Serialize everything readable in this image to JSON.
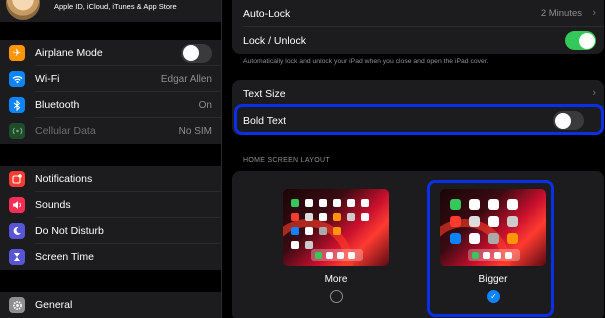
{
  "sidebar": {
    "account_subtitle": "Apple ID, iCloud, iTunes & App Store",
    "group1": [
      {
        "label": "Airplane Mode",
        "icon": "airplane-icon",
        "color": "#ff9500",
        "control": "toggle-off"
      },
      {
        "label": "Wi-Fi",
        "icon": "wifi-icon",
        "color": "#0a84ff",
        "value": "Edgar Allen"
      },
      {
        "label": "Bluetooth",
        "icon": "bluetooth-icon",
        "color": "#0a84ff",
        "value": "On"
      },
      {
        "label": "Cellular Data",
        "icon": "cellular-icon",
        "color": "#34c759",
        "value": "No SIM",
        "dimmed": true
      }
    ],
    "group2": [
      {
        "label": "Notifications",
        "icon": "notifications-icon",
        "color": "#ff3b30"
      },
      {
        "label": "Sounds",
        "icon": "sounds-icon",
        "color": "#ff2d55"
      },
      {
        "label": "Do Not Disturb",
        "icon": "moon-icon",
        "color": "#5856d6"
      },
      {
        "label": "Screen Time",
        "icon": "hourglass-icon",
        "color": "#5856d6"
      }
    ],
    "group3": [
      {
        "label": "General",
        "icon": "gear-icon",
        "color": "#8e8e93"
      }
    ]
  },
  "main": {
    "auto_lock": {
      "label": "Auto-Lock",
      "value": "2 Minutes"
    },
    "lock_unlock": {
      "label": "Lock / Unlock",
      "state": "on"
    },
    "lock_footnote": "Automatically lock and unlock your iPad when you close and open the iPad cover.",
    "text_size": {
      "label": "Text Size"
    },
    "bold_text": {
      "label": "Bold Text",
      "state": "off"
    },
    "home_screen_header": "HOME SCREEN LAYOUT",
    "layout_options": [
      {
        "label": "More",
        "selected": false
      },
      {
        "label": "Bigger",
        "selected": true
      }
    ]
  },
  "colors": {
    "highlight": "#0a2fe8",
    "toggle_on": "#34c759",
    "accent": "#0a84ff"
  }
}
